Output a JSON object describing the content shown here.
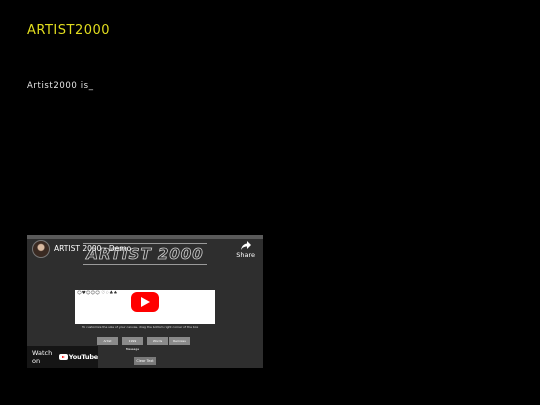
{
  "site": {
    "title": "ARTIST2000",
    "title_color": "#E2DD1E"
  },
  "main": {
    "intro": "Artist2000 is_"
  },
  "video": {
    "title": "ARTIST 2000 - Demo",
    "banner_text": "ARTIST 2000",
    "share_label": "Share",
    "watch_on": "Watch on",
    "platform": "YouTube",
    "panel_text": "☺♥☺☺☺ ♡♢♣♠",
    "caption_text": "To customize the size of your canvas, drag the bottom right corner of the box",
    "options": [
      "Artist",
      "1999 Message",
      "Words",
      "Remixes"
    ],
    "clear_label": "Clear Text",
    "accent_color": "#FF0000",
    "icons": [
      "avatar-icon",
      "share-arrow-icon",
      "play-icon",
      "youtube-logo-icon"
    ]
  }
}
